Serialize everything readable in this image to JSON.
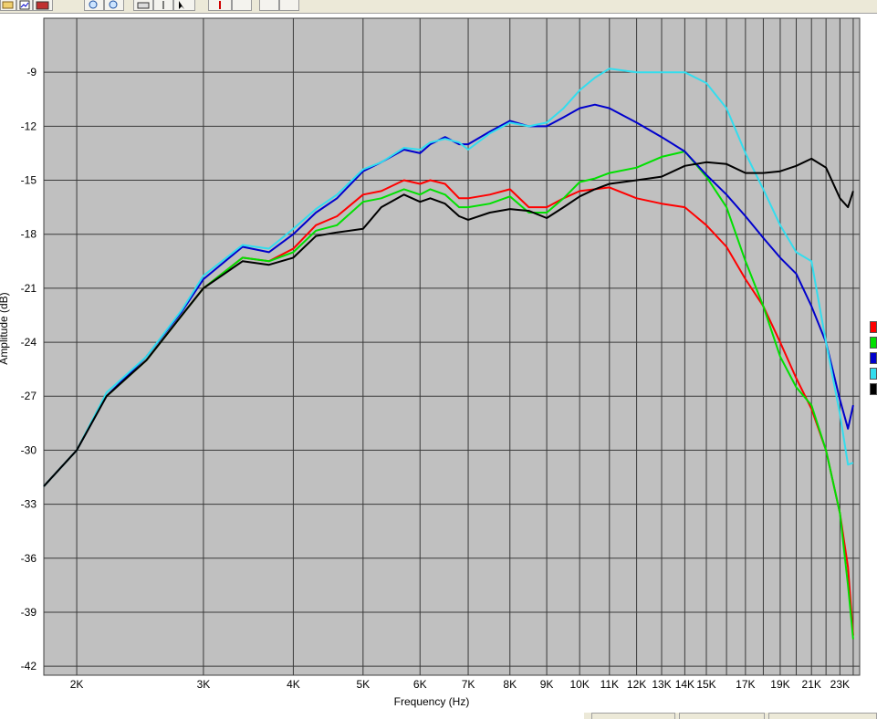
{
  "toolbar": {
    "buttons": [
      {
        "name": "open-icon"
      },
      {
        "name": "chart-icon"
      },
      {
        "name": "measure-icon"
      },
      {
        "name": "zoom-in-icon"
      },
      {
        "name": "zoom-out-icon"
      },
      {
        "name": "print-icon"
      },
      {
        "name": "cursor-icon"
      },
      {
        "name": "pointer-help-icon"
      },
      {
        "name": "marker-icon"
      },
      {
        "name": "blank-button"
      },
      {
        "name": "blank-button"
      },
      {
        "name": "blank-button"
      }
    ]
  },
  "chart_data": {
    "type": "line",
    "title": "",
    "xlabel": "Frequency (Hz)",
    "ylabel": "Amplitude (dB)",
    "x_scale": "log",
    "xlim": [
      1800,
      24500
    ],
    "ylim": [
      -42.5,
      -6
    ],
    "grid": true,
    "background": "#c0c0c0",
    "legend_position": "right",
    "y_ticks": [
      -9,
      -12,
      -15,
      -18,
      -21,
      -24,
      -27,
      -30,
      -33,
      -36,
      -39,
      -42
    ],
    "x_ticks": [
      {
        "v": 2000,
        "label": "2K"
      },
      {
        "v": 3000,
        "label": "3K"
      },
      {
        "v": 4000,
        "label": "4K"
      },
      {
        "v": 5000,
        "label": "5K"
      },
      {
        "v": 6000,
        "label": "6K"
      },
      {
        "v": 7000,
        "label": "7K"
      },
      {
        "v": 8000,
        "label": "8K"
      },
      {
        "v": 9000,
        "label": "9K"
      },
      {
        "v": 10000,
        "label": "10K"
      },
      {
        "v": 11000,
        "label": "11K"
      },
      {
        "v": 12000,
        "label": "12K"
      },
      {
        "v": 13000,
        "label": "13K"
      },
      {
        "v": 14000,
        "label": "14K"
      },
      {
        "v": 15000,
        "label": "15K"
      },
      {
        "v": 17000,
        "label": "17K"
      },
      {
        "v": 19000,
        "label": "19K"
      },
      {
        "v": 21000,
        "label": "21K"
      },
      {
        "v": 23000,
        "label": "23K"
      }
    ],
    "minor_gridlines": [
      16000,
      18000,
      20000,
      22000,
      24000
    ],
    "series": [
      {
        "color": "#ff0000",
        "x": [
          1800,
          2000,
          2200,
          2500,
          2800,
          3000,
          3400,
          3700,
          4000,
          4300,
          4600,
          5000,
          5300,
          5700,
          6000,
          6200,
          6500,
          6800,
          7000,
          7500,
          8000,
          8500,
          9000,
          9500,
          10000,
          10500,
          11000,
          12000,
          13000,
          14000,
          15000,
          16000,
          17000,
          18000,
          19000,
          20000,
          21000,
          22000,
          23000,
          23600,
          24000
        ],
        "y": [
          -32,
          -30,
          -27,
          -25,
          -22.5,
          -21,
          -19.3,
          -19.5,
          -18.8,
          -17.5,
          -17,
          -15.8,
          -15.6,
          -15,
          -15.2,
          -15,
          -15.2,
          -16,
          -16,
          -15.8,
          -15.5,
          -16.5,
          -16.5,
          -16,
          -15.6,
          -15.5,
          -15.4,
          -16,
          -16.3,
          -16.5,
          -17.5,
          -18.7,
          -20.5,
          -22,
          -24,
          -26,
          -27.7,
          -30,
          -33.5,
          -36.5,
          -40.3
        ]
      },
      {
        "color": "#00e000",
        "x": [
          1800,
          2000,
          2200,
          2500,
          2800,
          3000,
          3400,
          3700,
          4000,
          4300,
          4600,
          5000,
          5300,
          5700,
          6000,
          6200,
          6500,
          6800,
          7000,
          7500,
          8000,
          8500,
          9000,
          9500,
          10000,
          10500,
          11000,
          12000,
          13000,
          14000,
          15000,
          16000,
          17000,
          18000,
          19000,
          20000,
          21000,
          22000,
          23000,
          23600,
          24000
        ],
        "y": [
          -32,
          -30,
          -27,
          -25,
          -22.5,
          -21,
          -19.3,
          -19.5,
          -19,
          -17.8,
          -17.5,
          -16.2,
          -16,
          -15.5,
          -15.8,
          -15.5,
          -15.8,
          -16.5,
          -16.5,
          -16.3,
          -15.9,
          -16.8,
          -16.8,
          -16,
          -15.1,
          -14.9,
          -14.6,
          -14.3,
          -13.7,
          -13.4,
          -14.8,
          -16.5,
          -19.5,
          -22,
          -24.8,
          -26.5,
          -27.5,
          -30,
          -33.5,
          -37.5,
          -40.5
        ]
      },
      {
        "color": "#0000cc",
        "x": [
          1800,
          2000,
          2200,
          2500,
          2800,
          3000,
          3400,
          3700,
          4000,
          4300,
          4600,
          5000,
          5300,
          5700,
          6000,
          6200,
          6500,
          6800,
          7000,
          7500,
          8000,
          8500,
          9000,
          9500,
          10000,
          10500,
          11000,
          12000,
          13000,
          14000,
          15000,
          16000,
          17000,
          18000,
          19000,
          20000,
          21000,
          22000,
          23000,
          23600,
          24000
        ],
        "y": [
          -32,
          -30,
          -27,
          -24.8,
          -22.3,
          -20.5,
          -18.7,
          -19,
          -18,
          -16.8,
          -16,
          -14.5,
          -14,
          -13.3,
          -13.5,
          -13,
          -12.6,
          -13,
          -13,
          -12.3,
          -11.7,
          -12,
          -12,
          -11.5,
          -11,
          -10.8,
          -11,
          -11.8,
          -12.6,
          -13.4,
          -14.7,
          -15.8,
          -17,
          -18.2,
          -19.3,
          -20.2,
          -22,
          -24,
          -27.2,
          -28.8,
          -27.5
        ]
      },
      {
        "color": "#33ddee",
        "x": [
          1800,
          2000,
          2200,
          2500,
          2800,
          3000,
          3400,
          3700,
          4000,
          4300,
          4600,
          5000,
          5300,
          5700,
          6000,
          6200,
          6500,
          6800,
          7000,
          7500,
          8000,
          8500,
          9000,
          9500,
          10000,
          10500,
          11000,
          12000,
          13000,
          14000,
          15000,
          16000,
          17000,
          18000,
          19000,
          20000,
          21000,
          22000,
          23000,
          23600,
          24000
        ],
        "y": [
          -32,
          -30,
          -26.8,
          -24.8,
          -22.2,
          -20.3,
          -18.6,
          -18.8,
          -17.7,
          -16.6,
          -15.8,
          -14.4,
          -14,
          -13.2,
          -13.3,
          -12.9,
          -12.7,
          -12.9,
          -13.3,
          -12.4,
          -11.8,
          -12,
          -11.8,
          -11,
          -10,
          -9.3,
          -8.8,
          -9,
          -9,
          -9,
          -9.6,
          -11,
          -13.5,
          -15.5,
          -17.5,
          -19,
          -19.5,
          -24,
          -28,
          -30.8,
          -30.7
        ]
      },
      {
        "color": "#000000",
        "x": [
          1800,
          2000,
          2200,
          2500,
          2800,
          3000,
          3400,
          3700,
          4000,
          4300,
          4600,
          5000,
          5300,
          5700,
          6000,
          6200,
          6500,
          6800,
          7000,
          7500,
          8000,
          8500,
          9000,
          9500,
          10000,
          10500,
          11000,
          12000,
          13000,
          14000,
          15000,
          16000,
          17000,
          18000,
          19000,
          20000,
          21000,
          22000,
          23000,
          23600,
          24000
        ],
        "y": [
          -32,
          -30,
          -27,
          -25,
          -22.5,
          -21,
          -19.5,
          -19.7,
          -19.3,
          -18.1,
          -17.9,
          -17.7,
          -16.5,
          -15.8,
          -16.2,
          -16,
          -16.3,
          -17,
          -17.2,
          -16.8,
          -16.6,
          -16.7,
          -17.1,
          -16.5,
          -15.9,
          -15.5,
          -15.2,
          -15,
          -14.8,
          -14.2,
          -14,
          -14.1,
          -14.6,
          -14.6,
          -14.5,
          -14.2,
          -13.8,
          -14.3,
          -16,
          -16.5,
          -15.6
        ]
      }
    ]
  },
  "statusbar": {
    "cells": [
      "",
      "",
      ""
    ]
  }
}
